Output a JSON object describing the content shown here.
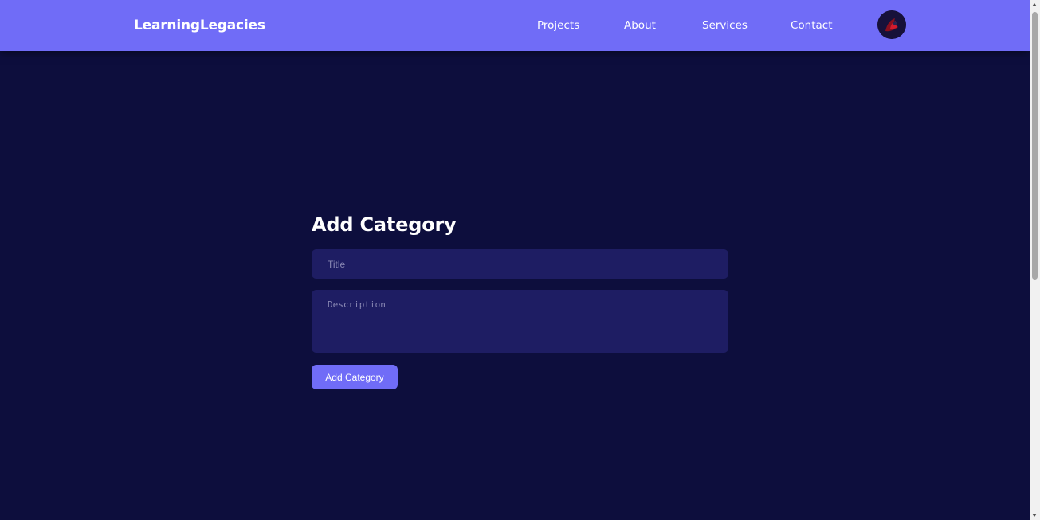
{
  "header": {
    "brand": "LearningLegacies",
    "nav": [
      {
        "label": "Projects"
      },
      {
        "label": "About"
      },
      {
        "label": "Services"
      },
      {
        "label": "Contact"
      }
    ],
    "avatar_icon": "user-avatar-icon"
  },
  "form": {
    "title": "Add Category",
    "title_placeholder": "Title",
    "description_placeholder": "Description",
    "submit_label": "Add Category"
  },
  "colors": {
    "navbar": "#706cf7",
    "background": "#0d0e3d",
    "field": "#1e1d63",
    "button": "#706cf7"
  }
}
